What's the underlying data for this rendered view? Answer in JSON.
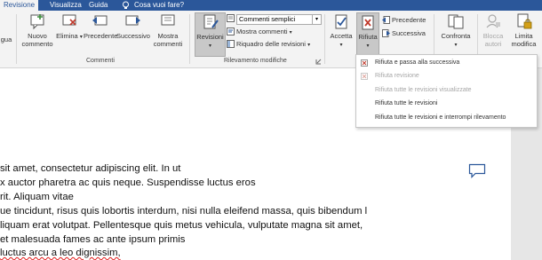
{
  "tabs": [
    "Revisione",
    "Visualizza",
    "Guida"
  ],
  "tellme": "Cosa vuoi fare?",
  "ribbon": {
    "lingua_partial": "gua",
    "nuovo_commento": [
      "Nuovo",
      "commento"
    ],
    "elimina": "Elimina",
    "precedente": "Precedente",
    "successivo": "Successivo",
    "mostra_commenti": [
      "Mostra",
      "commenti"
    ],
    "group_commenti": "Commenti",
    "revisioni": "Revisioni",
    "commenti_semplici": "Commenti semplici",
    "mostra_commenti_dd": "Mostra commenti",
    "riquadro": "Riquadro delle revisioni",
    "group_rilevamento": "Rilevamento modifiche",
    "accetta": "Accetta",
    "rifiuta": "Rifiuta",
    "prec_rev": "Precedente",
    "succ_rev": "Successiva",
    "confronta": "Confronta",
    "blocca_autori": [
      "Blocca",
      "autori"
    ],
    "limita_modifica": [
      "Limita",
      "modifica"
    ]
  },
  "menu": [
    {
      "label": "Rifiuta e passa alla successiva",
      "enabled": true,
      "icon": "reject-next-icon"
    },
    {
      "label": "Rifiuta revisione",
      "enabled": false,
      "icon": "reject-icon"
    },
    {
      "label": "Rifiuta tutte le revisioni visualizzate",
      "enabled": false,
      "icon": "none"
    },
    {
      "label": "Rifiuta tutte le revisioni",
      "enabled": true,
      "icon": "none"
    },
    {
      "label": "Rifiuta tutte le revisioni e interrompi rilevamento",
      "enabled": true,
      "icon": "none"
    }
  ],
  "document": {
    "lines": [
      "sit amet, consectetur adipiscing elit. In ut",
      "x auctor pharetra ac quis neque. Suspendisse luctus eros",
      "rit. Aliquam vitae",
      "ue tincidunt, risus quis lobortis interdum, nisi nulla eleifend massa, quis bibendum l",
      "liquam erat volutpat. Pellentesque quis metus vehicula, vulputate magna sit amet,",
      " et malesuada fames ac ante ipsum primis",
      "luctus arcu a leo dignissim,"
    ]
  },
  "colors": {
    "accent": "#2b579a",
    "rifiuta_icon": "#c0392b"
  }
}
